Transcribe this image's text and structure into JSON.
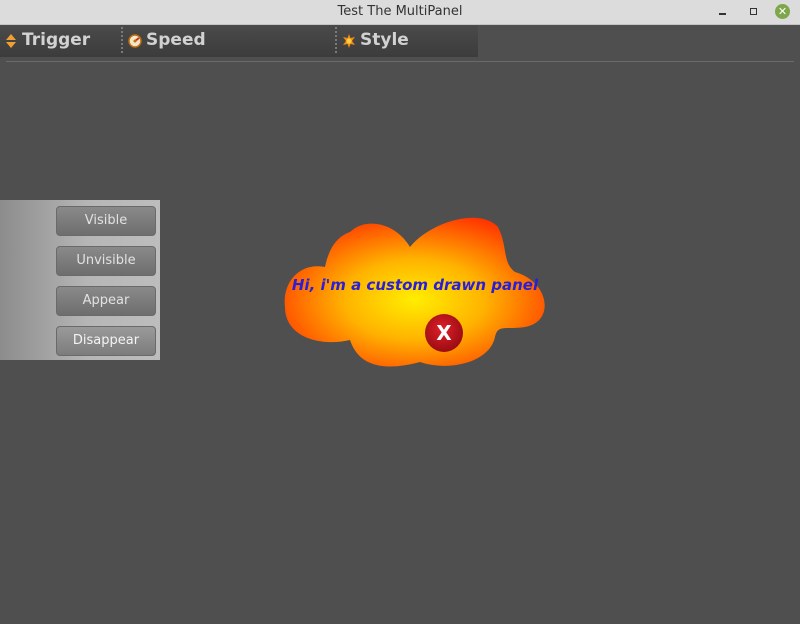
{
  "window": {
    "title": "Test The MultiPanel"
  },
  "toolbar": {
    "items": [
      {
        "label": "Trigger",
        "icon": "up-down-arrows-icon"
      },
      {
        "label": "Speed",
        "icon": "speed-gauge-icon"
      },
      {
        "label": "Style",
        "icon": "sun-star-icon"
      }
    ]
  },
  "side_panel": {
    "buttons": [
      {
        "label": "Visible"
      },
      {
        "label": "Unvisible"
      },
      {
        "label": "Appear"
      },
      {
        "label": "Disappear"
      }
    ]
  },
  "custom_panel": {
    "text": "Hi, i'm a custom drawn panel",
    "close_label": "X",
    "colors": {
      "outer": "#ff3300",
      "inner": "#ffee00",
      "text": "#2a1fd6",
      "close_bg": "#c8141e"
    }
  }
}
